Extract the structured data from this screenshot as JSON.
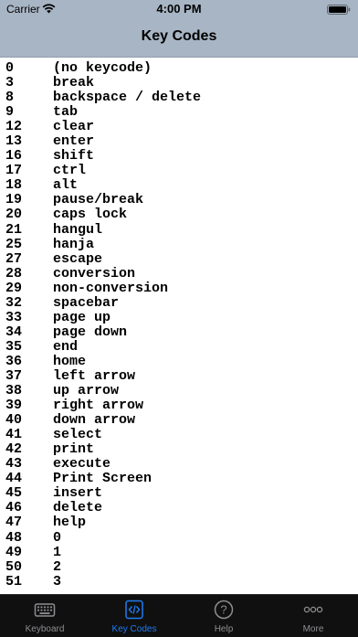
{
  "status_bar": {
    "carrier": "Carrier",
    "time": "4:00 PM",
    "icons": [
      "wifi-icon",
      "battery-icon"
    ]
  },
  "nav": {
    "title": "Key Codes"
  },
  "key_codes": [
    {
      "code": "0",
      "name": "(no keycode)"
    },
    {
      "code": "3",
      "name": "break"
    },
    {
      "code": "8",
      "name": "backspace / delete"
    },
    {
      "code": "9",
      "name": "tab"
    },
    {
      "code": "12",
      "name": "clear"
    },
    {
      "code": "13",
      "name": "enter"
    },
    {
      "code": "16",
      "name": "shift"
    },
    {
      "code": "17",
      "name": "ctrl"
    },
    {
      "code": "18",
      "name": "alt"
    },
    {
      "code": "19",
      "name": "pause/break"
    },
    {
      "code": "20",
      "name": "caps lock"
    },
    {
      "code": "21",
      "name": "hangul"
    },
    {
      "code": "25",
      "name": "hanja"
    },
    {
      "code": "27",
      "name": "escape"
    },
    {
      "code": "28",
      "name": "conversion"
    },
    {
      "code": "29",
      "name": "non-conversion"
    },
    {
      "code": "32",
      "name": "spacebar"
    },
    {
      "code": "33",
      "name": "page up"
    },
    {
      "code": "34",
      "name": "page down"
    },
    {
      "code": "35",
      "name": "end"
    },
    {
      "code": "36",
      "name": "home"
    },
    {
      "code": "37",
      "name": "left arrow"
    },
    {
      "code": "38",
      "name": "up arrow"
    },
    {
      "code": "39",
      "name": "right arrow"
    },
    {
      "code": "40",
      "name": "down arrow"
    },
    {
      "code": "41",
      "name": "select"
    },
    {
      "code": "42",
      "name": "print"
    },
    {
      "code": "43",
      "name": "execute"
    },
    {
      "code": "44",
      "name": "Print Screen"
    },
    {
      "code": "45",
      "name": "insert"
    },
    {
      "code": "46",
      "name": "delete"
    },
    {
      "code": "47",
      "name": "help"
    },
    {
      "code": "48",
      "name": "0"
    },
    {
      "code": "49",
      "name": "1"
    },
    {
      "code": "50",
      "name": "2"
    },
    {
      "code": "51",
      "name": "3"
    }
  ],
  "tab_bar": {
    "active_color": "#1e7bf2",
    "inactive_color": "#8e8e93",
    "tabs": [
      {
        "label": "Keyboard",
        "icon": "keyboard-icon",
        "active": false
      },
      {
        "label": "Key Codes",
        "icon": "code-icon",
        "active": true
      },
      {
        "label": "Help",
        "icon": "help-icon",
        "active": false
      },
      {
        "label": "More",
        "icon": "more-icon",
        "active": false
      }
    ]
  }
}
